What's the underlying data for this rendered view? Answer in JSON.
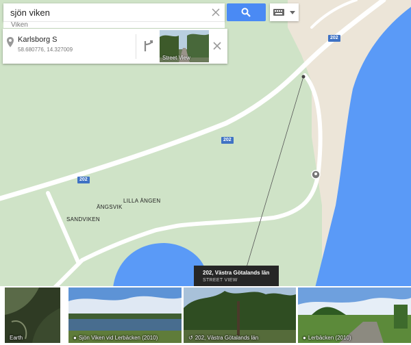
{
  "search": {
    "value": "sjön viken",
    "suggestion": "Viken"
  },
  "card": {
    "title": "Karlsborg S",
    "coords": "58.680776, 14.327009",
    "street_view_label": "Street View"
  },
  "map_labels": {
    "road_number": "202",
    "places": [
      "LILLA ÄNGEN",
      "ÄNGSVIK",
      "SANDVIKEN"
    ]
  },
  "tooltip": {
    "title": "202, Västra Götalands län",
    "subtitle": "STREET VIEW"
  },
  "filmstrip": [
    {
      "label": "Earth",
      "icon": ""
    },
    {
      "label": "Sjön Viken vid Lerbäcken (2010)",
      "icon": "camera-icon"
    },
    {
      "label": "202, Västra Götalands län",
      "icon": "streetview-360-icon"
    },
    {
      "label": "Lerbäcken (2010)",
      "icon": "camera-icon"
    }
  ],
  "colors": {
    "land": "#cfe3c7",
    "water": "#5a9af7",
    "road": "#ffffff",
    "sand": "#ece5d8",
    "accent": "#4a8af4"
  }
}
